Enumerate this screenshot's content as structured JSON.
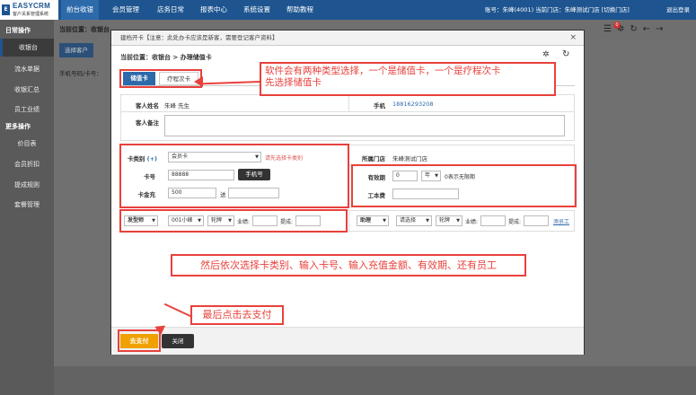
{
  "app": {
    "logo_mark": "E",
    "logo_title": "EASYCRM",
    "logo_subtitle": "客户关系管理系统"
  },
  "topnav": {
    "items": [
      "前台收银",
      "会员管理",
      "店务日常",
      "报表中心",
      "系统设置",
      "帮助教程"
    ],
    "user_text": "账号：朱峰(4001)  当前门店：朱峰测试门店 [切换门店]",
    "logout": "退出登录"
  },
  "sidebar": {
    "section1": "日常操作",
    "items1": [
      "收银台",
      "流水单据",
      "收银汇总",
      "员工业绩"
    ],
    "section2": "更多操作",
    "items2": [
      "价目表",
      "会员折扣",
      "提成规则",
      "套餐管理"
    ]
  },
  "main": {
    "location": "当前位置：收银台",
    "select_customer": "选择客户",
    "phone_label": "手机号码/卡号："
  },
  "modal": {
    "title": "建档开卡【注意：此处办卡应该是新客，需要登记客户资料】",
    "close": "×",
    "breadcrumb": "当前位置：收银台 > 办理储值卡",
    "tabs": [
      "储值卡",
      "疗程次卡"
    ],
    "customer_name_label": "客人姓名",
    "customer_name": "朱峰 先生",
    "phone_label": "手机",
    "phone": "18816293208",
    "remark_label": "客人备注",
    "card_type_label": "卡类别",
    "card_type_add": "(+)",
    "card_type_value": "会员卡",
    "card_type_hint": "请先选择卡类别",
    "store_label": "所属门店",
    "store_value": "朱峰测试门店",
    "card_no_label": "卡号",
    "card_no_value": "88888",
    "phone_btn": "手机号",
    "validity_label": "有效期",
    "validity_value": "0",
    "validity_unit": "年",
    "validity_hint": "0表示无限期",
    "amount_label": "卡金充",
    "amount_value": "500",
    "gift_label": "送",
    "staff_no_label": "工本费",
    "role1": "发型师",
    "staff1": "001小峰",
    "type1": "轮牌",
    "perf_label": "业绩:",
    "commission_label": "提成:",
    "role2": "助理",
    "staff2": "请选择",
    "type2": "轮牌",
    "add_staff": "添员工",
    "pay_btn": "去支付",
    "close_btn": "关闭"
  },
  "annotations": {
    "note1": "软件会有两种类型选择，一个是储值卡，一个是疗程次卡\n先选择储值卡",
    "note2": "然后依次选择卡类别、输入卡号、输入充值金额、有效期、还有员工",
    "note3": "最后点击去支付"
  },
  "colors": {
    "nav_bg": "#1e5590",
    "annotation": "#e8413c",
    "pay_button": "#f0a000"
  }
}
